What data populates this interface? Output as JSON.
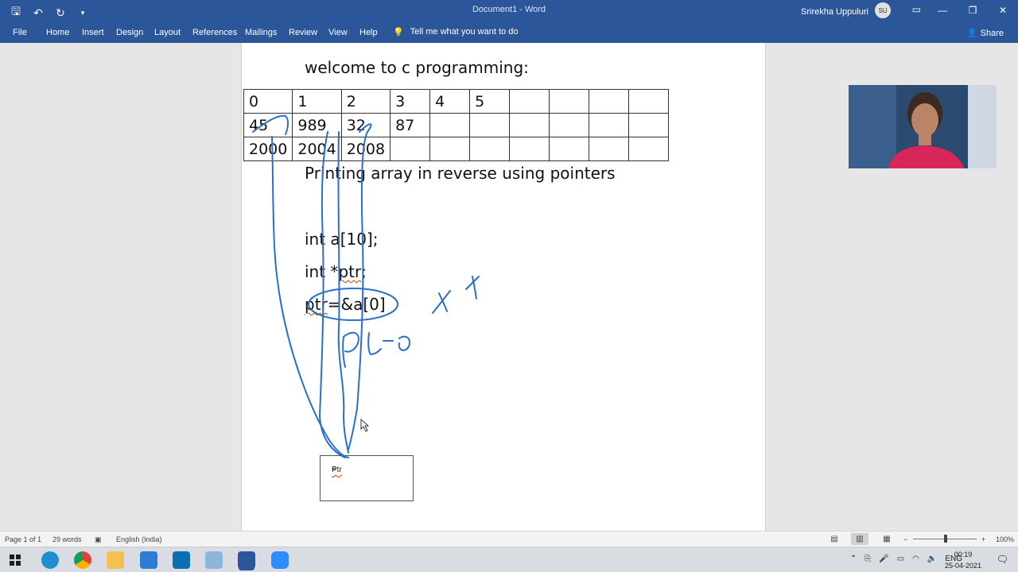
{
  "window": {
    "title": "Document1  -  Word",
    "user_name": "Srirekha Uppuluri",
    "user_initials": "SU"
  },
  "ribbon": {
    "tabs": [
      "File",
      "Home",
      "Insert",
      "Design",
      "Layout",
      "References",
      "Mailings",
      "Review",
      "View",
      "Help"
    ],
    "tell_me": "Tell me what you want to do",
    "share": "Share"
  },
  "document": {
    "heading": "welcome to c programming:",
    "table": {
      "rows": [
        [
          "0",
          "1",
          "2",
          "3",
          "4",
          "5",
          "",
          "",
          "",
          ""
        ],
        [
          "45",
          "989",
          "32",
          "87",
          "",
          "",
          "",
          "",
          "",
          ""
        ],
        [
          "2000",
          "2004",
          "2008",
          "",
          "",
          "",
          "",
          "",
          "",
          ""
        ]
      ]
    },
    "subtitle": "Printing array in reverse using pointers",
    "code_line1": "int a[10];",
    "code_line2_prefix": "int *",
    "code_line2_squiggle": "ptr",
    "code_line2_suffix": ";",
    "code_line3_squiggle": "ptr",
    "code_line3_suffix": "=&a[0]",
    "textbox_squiggle": "Ptr",
    "textbox_suffix": "="
  },
  "status": {
    "page": "Page 1 of 1",
    "words": "29 words",
    "language": "English (India)",
    "zoom": "100%"
  },
  "taskbar": {
    "language": "ENG",
    "time": "00:19",
    "date": "25-04-2021"
  }
}
